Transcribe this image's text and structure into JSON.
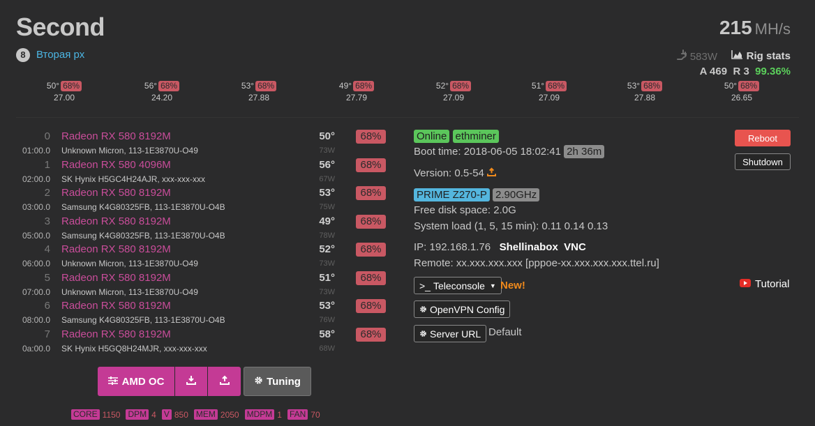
{
  "header": {
    "rig_title": "Second",
    "rig_id": "8",
    "rig_group": "Вторая рх",
    "hashrate_value": "215",
    "hashrate_unit": "MH/s",
    "power": "583W",
    "rig_stats_label": "Rig stats",
    "shares_accepted": "A 469",
    "shares_rejected": "R 3",
    "shares_pct": "99.36%"
  },
  "summary": [
    {
      "temp": "50°",
      "fan": "68%",
      "hashrate": "27.00"
    },
    {
      "temp": "56°",
      "fan": "68%",
      "hashrate": "24.20"
    },
    {
      "temp": "53°",
      "fan": "68%",
      "hashrate": "27.88"
    },
    {
      "temp": "49°",
      "fan": "68%",
      "hashrate": "27.79"
    },
    {
      "temp": "52°",
      "fan": "68%",
      "hashrate": "27.09"
    },
    {
      "temp": "51°",
      "fan": "68%",
      "hashrate": "27.09"
    },
    {
      "temp": "53°",
      "fan": "68%",
      "hashrate": "27.88"
    },
    {
      "temp": "50°",
      "fan": "68%",
      "hashrate": "26.65"
    }
  ],
  "gpus": [
    {
      "idx": "0",
      "name": "Radeon RX 580 8192M",
      "bus": "01:00.0",
      "mem": "Unknown Micron, 113-1E3870U-O49",
      "temp": "50°",
      "watt": "73W",
      "fan": "68%"
    },
    {
      "idx": "1",
      "name": "Radeon RX 580 4096M",
      "bus": "02:00.0",
      "mem": "SK Hynix H5GC4H24AJR, xxx-xxx-xxx",
      "temp": "56°",
      "watt": "67W",
      "fan": "68%"
    },
    {
      "idx": "2",
      "name": "Radeon RX 580 8192M",
      "bus": "03:00.0",
      "mem": "Samsung K4G80325FB, 113-1E3870U-O4B",
      "temp": "53°",
      "watt": "75W",
      "fan": "68%"
    },
    {
      "idx": "3",
      "name": "Radeon RX 580 8192M",
      "bus": "05:00.0",
      "mem": "Samsung K4G80325FB, 113-1E3870U-O4B",
      "temp": "49°",
      "watt": "78W",
      "fan": "68%"
    },
    {
      "idx": "4",
      "name": "Radeon RX 580 8192M",
      "bus": "06:00.0",
      "mem": "Unknown Micron, 113-1E3870U-O49",
      "temp": "52°",
      "watt": "73W",
      "fan": "68%"
    },
    {
      "idx": "5",
      "name": "Radeon RX 580 8192M",
      "bus": "07:00.0",
      "mem": "Unknown Micron, 113-1E3870U-O49",
      "temp": "51°",
      "watt": "73W",
      "fan": "68%"
    },
    {
      "idx": "6",
      "name": "Radeon RX 580 8192M",
      "bus": "08:00.0",
      "mem": "Samsung K4G80325FB, 113-1E3870U-O4B",
      "temp": "53°",
      "watt": "76W",
      "fan": "68%"
    },
    {
      "idx": "7",
      "name": "Radeon RX 580 8192M",
      "bus": "0a:00.0",
      "mem": "SK Hynix H5GQ8H24MJR, xxx-xxx-xxx",
      "temp": "58°",
      "watt": "68W",
      "fan": "68%"
    }
  ],
  "oc": {
    "amd_oc_label": "AMD OC",
    "tuning_label": "Tuning",
    "core_label": "CORE",
    "core_value": "1150",
    "dpm_label": "DPM",
    "dpm_value": "4",
    "v_label": "V",
    "v_value": "850",
    "mem_label": "MEM",
    "mem_value": "2050",
    "mdpm_label": "MDPM",
    "mdpm_value": "1",
    "fan_label": "FAN",
    "fan_value": "70"
  },
  "info": {
    "status": "Online",
    "miner": "ethminer",
    "boot_time": "Boot time: 2018-06-05 18:02:41",
    "uptime": "2h 36m",
    "version": "Version: 0.5-54",
    "motherboard": "PRIME Z270-P",
    "cpu_freq": "2.90GHz",
    "disk": "Free disk space: 2.0G",
    "load": "System load (1, 5, 15 min): 0.11 0.14 0.13",
    "ip": "IP: 192.168.1.76",
    "shellinabox": "Shellinabox",
    "vnc": "VNC",
    "remote": "Remote: xx.xxx.xxx.xxx [pppoe-xx.xxx.xxx.xxx.ttel.ru]",
    "teleconsole_label": "Teleconsole",
    "new_label": "New!",
    "openvpn_label": "OpenVPN Config",
    "server_url_label": "Server URL",
    "server_url_value": "Default",
    "reboot_label": "Reboot",
    "shutdown_label": "Shutdown",
    "tutorial_label": "Tutorial"
  },
  "colors": {
    "accent_pink": "#c43a95",
    "gpu_name": "#c94d9a",
    "fan_badge": "#c95863",
    "online_green": "#5bc65b",
    "reboot_red": "#e8544f",
    "link_blue": "#4cb6e4"
  }
}
